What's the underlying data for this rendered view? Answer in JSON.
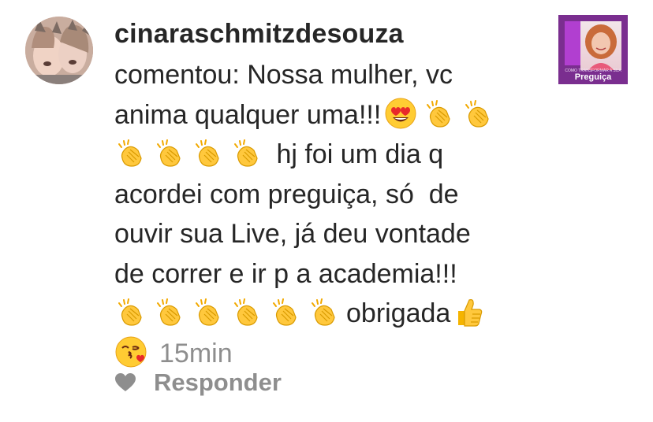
{
  "comment": {
    "username": "cinaraschmitzdesouza",
    "lines": [
      "comentou: Nossa mulher, vc",
      "anima qualquer uma!!!",
      "hj foi um dia q",
      "acordei com preguiça, só  de",
      "ouvir sua Live, já deu vontade",
      "de correr e ir p a academia!!!",
      "obrigada"
    ],
    "time": "15min",
    "emojis": {
      "heart_eyes": "smiling-face-with-heart-eyes-icon",
      "clap": "clapping-hands-icon",
      "thumbs_up": "thumbs-up-icon",
      "kiss": "face-blowing-kiss-icon"
    }
  },
  "post_thumbnail": {
    "subtitle": "COMO TRANSFORMAR A SUA",
    "title": "Preguiça",
    "color": "#7a2e8f"
  },
  "actions": {
    "reply_label": "Responder"
  },
  "colors": {
    "text": "#262626",
    "muted": "#8e8e8e"
  }
}
